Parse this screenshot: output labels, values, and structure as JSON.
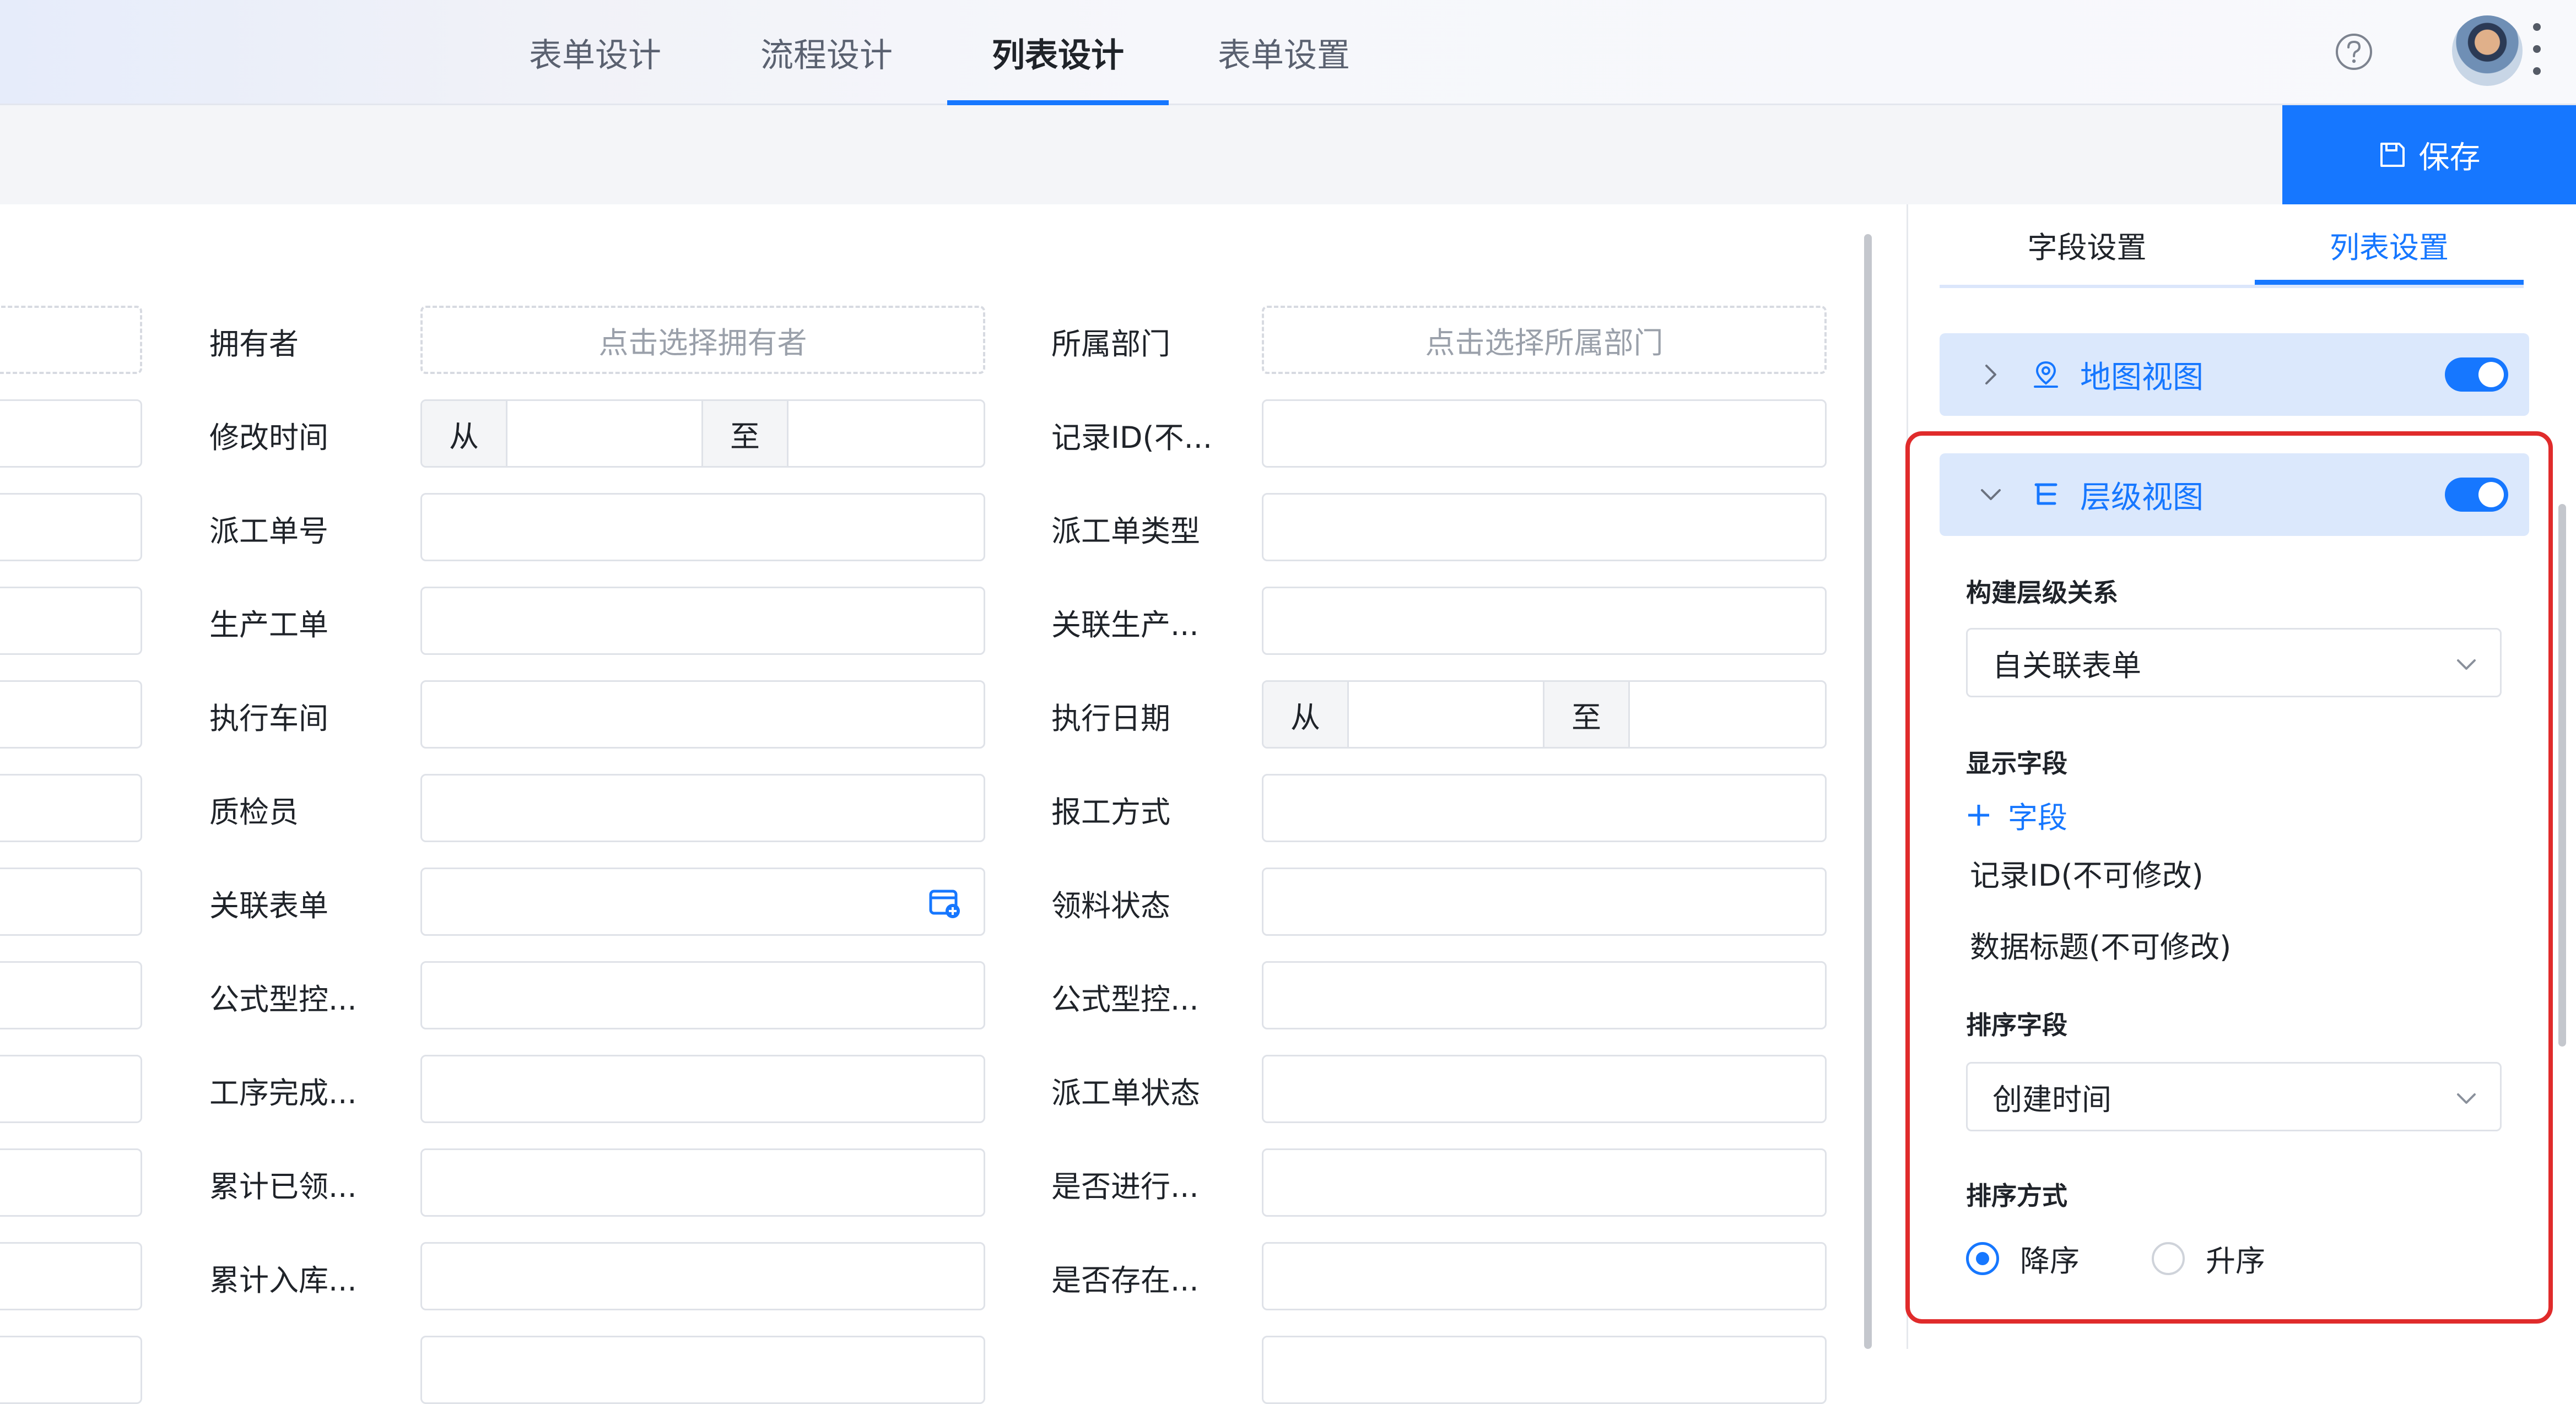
{
  "nav": {
    "tabs": [
      {
        "label": "表单设计"
      },
      {
        "label": "流程设计"
      },
      {
        "label": "列表设计"
      },
      {
        "label": "表单设置"
      }
    ],
    "active_tab": "列表设计",
    "help_icon": "help-circle-icon",
    "menu_icon": "more-vertical-icon"
  },
  "toolbar": {
    "save_label": "保存",
    "save_icon": "save-icon"
  },
  "form": {
    "owner": {
      "label": "拥有者",
      "placeholder": "点击选择拥有者"
    },
    "dept": {
      "label": "所属部门",
      "placeholder": "点击选择所属部门"
    },
    "range_from": "从",
    "range_to": "至",
    "left_labels": [
      "修改时间",
      "派工单号",
      "生产工单",
      "执行车间",
      "质检员",
      "关联表单",
      "公式型控...",
      "工序完成...",
      "累计已领...",
      "累计入库..."
    ],
    "right_labels": [
      "记录ID(不...",
      "派工单类型",
      "关联生产...",
      "执行日期",
      "报工方式",
      "领料状态",
      "公式型控...",
      "派工单状态",
      "是否进行...",
      "是否存在..."
    ]
  },
  "panel": {
    "tabs": [
      "字段设置",
      "列表设置"
    ],
    "active_tab": "列表设置",
    "map_view": {
      "title": "地图视图",
      "enabled": true,
      "icon": "map-pin-icon"
    },
    "tree_view": {
      "title": "层级视图",
      "enabled": true,
      "icon": "hierarchy-icon",
      "build_label": "构建层级关系",
      "build_value": "自关联表单",
      "display_label": "显示字段",
      "add_field": "字段",
      "fields": [
        "记录ID(不可修改)",
        "数据标题(不可修改)"
      ],
      "sort_field_label": "排序字段",
      "sort_field_value": "创建时间",
      "sort_order_label": "排序方式",
      "order_desc": "降序",
      "order_asc": "升序",
      "selected_order": "降序"
    }
  },
  "colors": {
    "accent": "#1677ff",
    "highlight": "#e02b2b"
  }
}
